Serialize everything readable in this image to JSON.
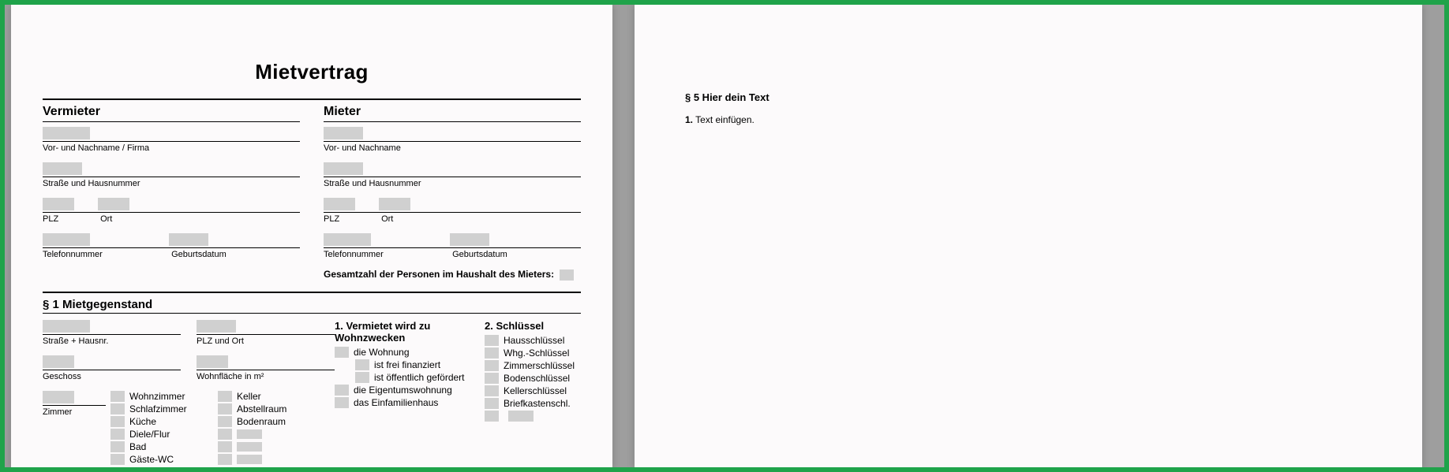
{
  "title": "Mietvertrag",
  "vermieter": {
    "head": "Vermieter",
    "name_label": "Vor- und Nachname / Firma",
    "street_label": "Straße und Hausnummer",
    "plz_label": "PLZ",
    "ort_label": "Ort",
    "tel_label": "Telefonnummer",
    "dob_label": "Geburtsdatum"
  },
  "mieter": {
    "head": "Mieter",
    "name_label": "Vor- und Nachname",
    "street_label": "Straße und Hausnummer",
    "plz_label": "PLZ",
    "ort_label": "Ort",
    "tel_label": "Telefonnummer",
    "dob_label": "Geburtsdatum",
    "total_label": "Gesamtzahl der Personen im Haushalt des Mieters:"
  },
  "s1": {
    "head": "§ 1 Mietgegenstand",
    "street_label": "Straße + Hausnr.",
    "city_label": "PLZ und Ort",
    "floor_label": "Geschoss",
    "area_label": "Wohnfläche in m²",
    "rooms_label": "Zimmer",
    "rooms_col1": [
      "Wohnzimmer",
      "Schlafzimmer",
      "Küche",
      "Diele/Flur",
      "Bad",
      "Gäste-WC"
    ],
    "rooms_col2": [
      "Keller",
      "Abstellraum",
      "Bodenraum"
    ],
    "purpose_head": "1. Vermietet wird zu Wohnzwecken",
    "purpose_items": {
      "a": "die Wohnung",
      "a1": "ist frei finanziert",
      "a2": "ist öffentlich gefördert",
      "b": "die Eigentumswohnung",
      "c": "das Einfamilienhaus"
    },
    "keys_head": "2. Schlüssel",
    "keys": [
      "Hausschlüssel",
      "Whg.-Schlüssel",
      "Zimmerschlüssel",
      "Bodenschlüssel",
      "Kellerschlüssel",
      "Briefkastenschl."
    ]
  },
  "s5": {
    "head": "§ 5 Hier dein Text",
    "body_num": "1.",
    "body": "Text einfügen."
  }
}
